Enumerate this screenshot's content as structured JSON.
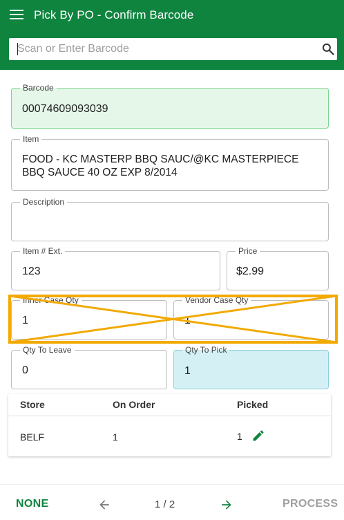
{
  "appbar": {
    "title": "Pick By PO - Confirm Barcode",
    "menu_icon": "hamburger-menu-icon"
  },
  "search": {
    "placeholder": "Scan or Enter Barcode",
    "value": "",
    "icon": "search-icon"
  },
  "form": {
    "barcode": {
      "label": "Barcode",
      "value": "00074609093039"
    },
    "item": {
      "label": "Item",
      "line1": "FOOD - KC MASTERP BBQ SAUC/@KC MASTERPIECE",
      "line2": "BBQ SAUCE 40 OZ EXP 8/2014"
    },
    "description": {
      "label": "Description",
      "value": ""
    },
    "item_ext": {
      "label": "Item # Ext.",
      "value": "123"
    },
    "price": {
      "label": "Price",
      "value": "$2.99"
    },
    "inner_case_qty": {
      "label": "Inner Case Qty",
      "value": "1"
    },
    "vendor_case_qty": {
      "label": "Vendor Case Qty",
      "value": "1"
    },
    "qty_to_leave": {
      "label": "Qty To Leave",
      "value": "0"
    },
    "qty_to_pick": {
      "label": "Qty To Pick",
      "value": "1"
    }
  },
  "table": {
    "headers": {
      "store": "Store",
      "on_order": "On Order",
      "picked": "Picked"
    },
    "rows": [
      {
        "store": "BELF",
        "on_order": "1",
        "picked": "1",
        "action_icon": "pencil-edit-icon"
      }
    ]
  },
  "footer": {
    "none_label": "NONE",
    "prev_icon": "arrow-left-icon",
    "pager": "1 / 2",
    "next_icon": "arrow-right-icon",
    "process_label": "PROCESS"
  },
  "colors": {
    "primary": "#0f843f",
    "highlight_green": "#e5f7e9",
    "highlight_blue": "#d4f0f4",
    "overlay_orange": "#f2a900",
    "disabled": "#9e9e9e"
  }
}
